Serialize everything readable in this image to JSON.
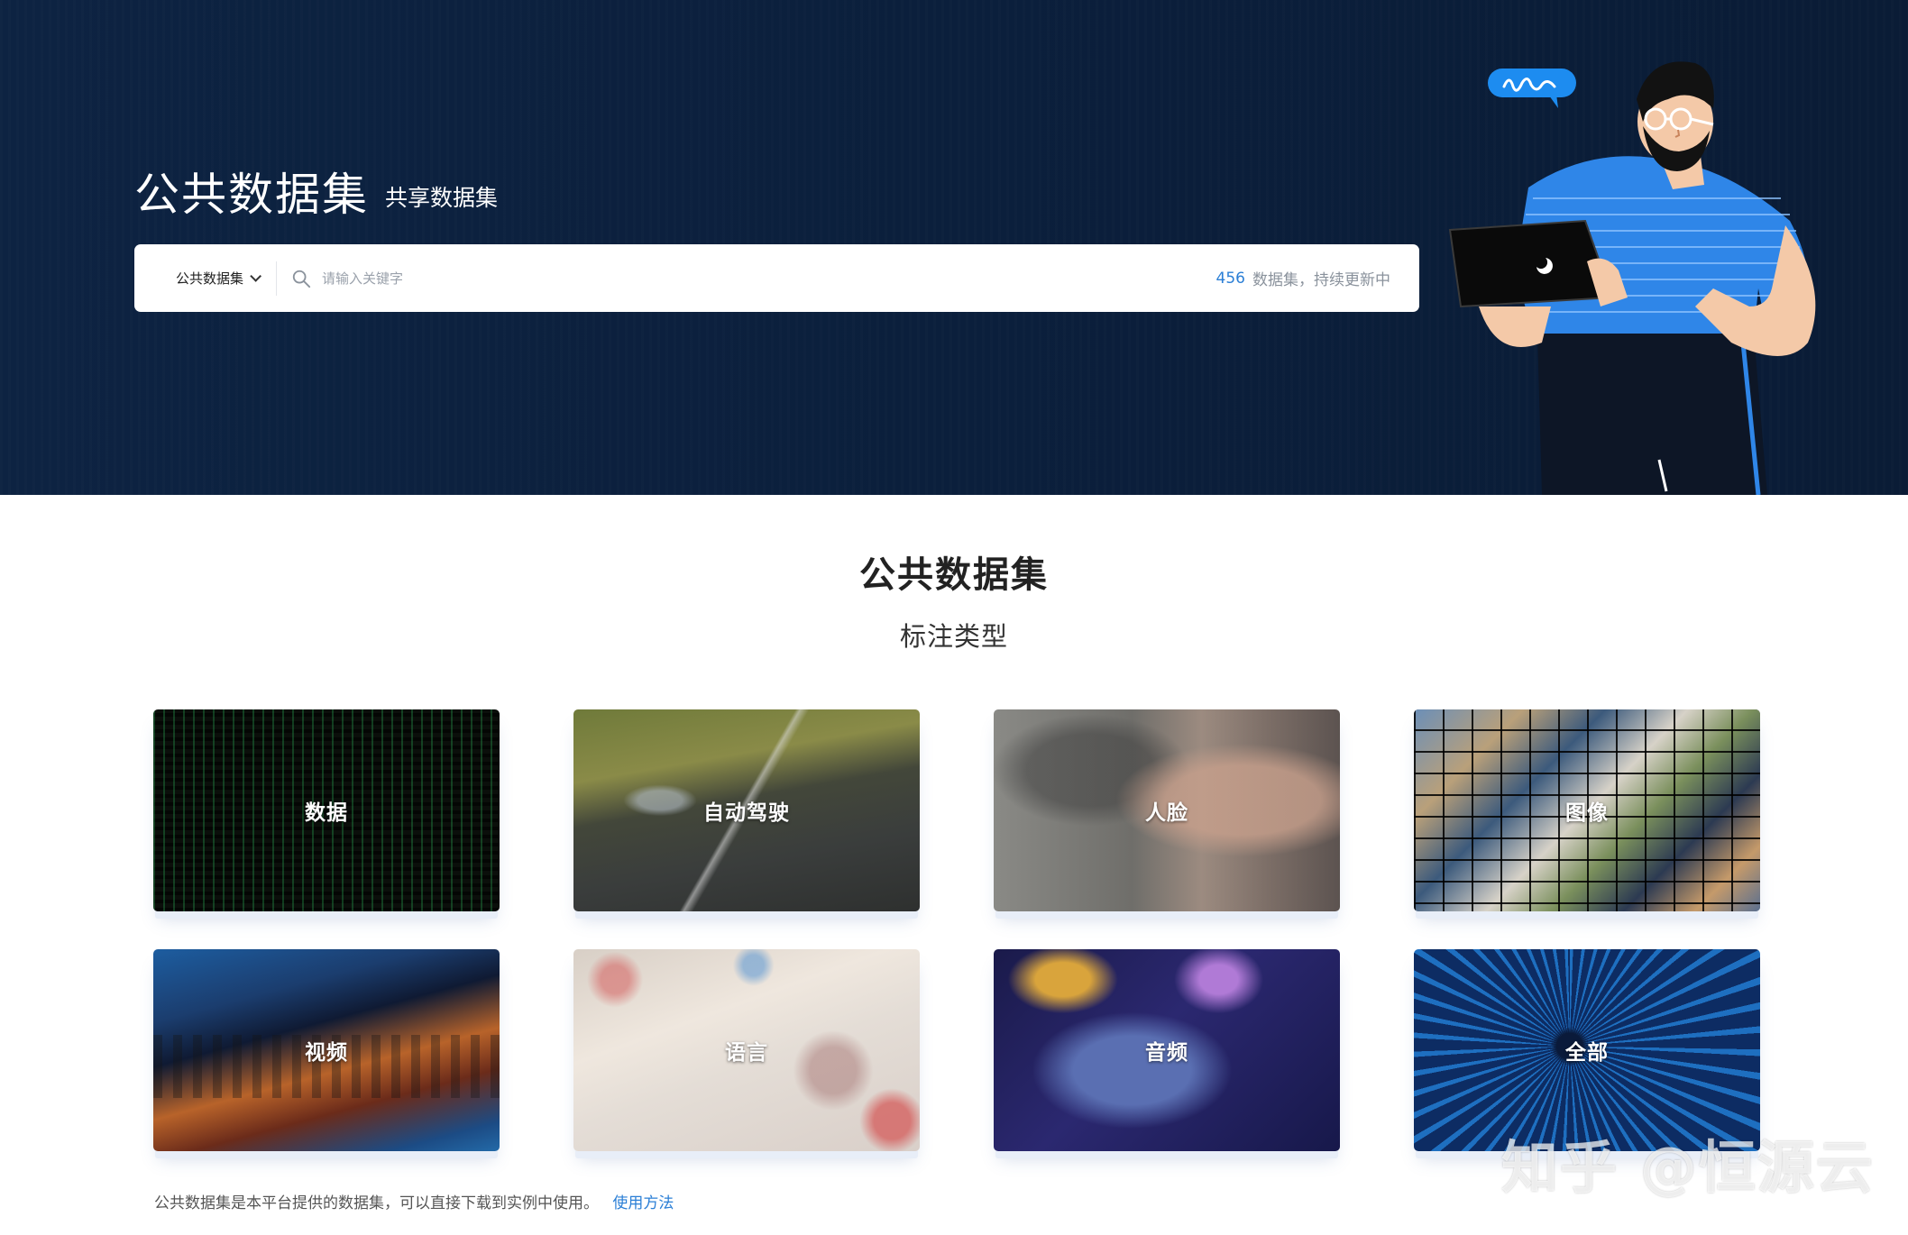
{
  "hero": {
    "title": "公共数据集",
    "subtitle": "共享数据集"
  },
  "search": {
    "scope_label": "公共数据集",
    "placeholder": "请输入关键字",
    "count": "456",
    "count_suffix": "数据集，持续更新中"
  },
  "section": {
    "title": "公共数据集",
    "subtitle": "标注类型"
  },
  "categories": [
    {
      "label": "数据"
    },
    {
      "label": "自动驾驶"
    },
    {
      "label": "人脸"
    },
    {
      "label": "图像"
    },
    {
      "label": "视频"
    },
    {
      "label": "语言"
    },
    {
      "label": "音频"
    },
    {
      "label": "全部"
    }
  ],
  "footer": {
    "note": "公共数据集是本平台提供的数据集，可以直接下载到实例中使用。",
    "link": "使用方法"
  },
  "watermark": "知乎 @恒源云",
  "colors": {
    "hero_bg": "#0b1f3c",
    "accent": "#2b7fd6"
  }
}
